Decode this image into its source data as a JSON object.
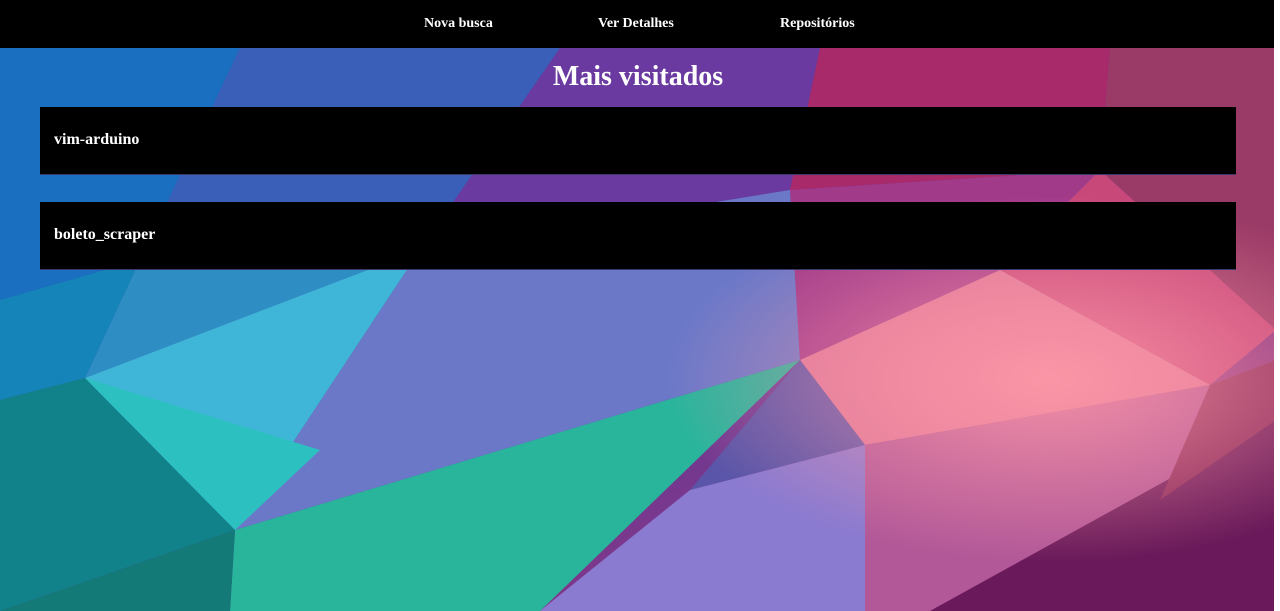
{
  "nav": {
    "items": [
      {
        "label": "Nova busca"
      },
      {
        "label": "Ver Detalhes"
      },
      {
        "label": "Repositórios"
      }
    ]
  },
  "main": {
    "title": "Mais visitados",
    "repos": [
      {
        "name": "vim-arduino"
      },
      {
        "name": "boleto_scraper"
      }
    ]
  },
  "colors": {
    "navbar": "#000000",
    "card": "#000000",
    "text": "#ffffff"
  }
}
